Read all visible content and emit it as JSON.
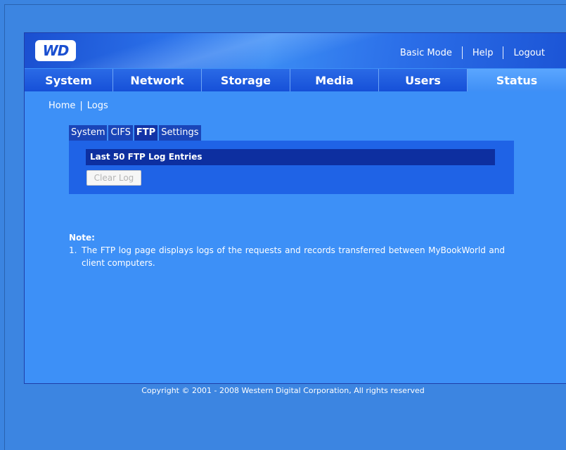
{
  "header": {
    "logo_text": "WD",
    "links": [
      "Basic Mode",
      "Help",
      "Logout"
    ]
  },
  "nav": {
    "items": [
      {
        "label": "System"
      },
      {
        "label": "Network"
      },
      {
        "label": "Storage"
      },
      {
        "label": "Media"
      },
      {
        "label": "Users"
      },
      {
        "label": "Status"
      }
    ],
    "active": "Status"
  },
  "breadcrumb": {
    "home": "Home",
    "separator": "|",
    "current": "Logs"
  },
  "subtabs": {
    "items": [
      {
        "label": "System"
      },
      {
        "label": "CIFS"
      },
      {
        "label": "FTP"
      },
      {
        "label": "Settings"
      }
    ],
    "active": "FTP"
  },
  "log_panel": {
    "title": "Last 50 FTP Log Entries",
    "clear_button": "Clear Log"
  },
  "note": {
    "title": "Note:",
    "items": [
      {
        "num": "1.",
        "text": "The FTP log page displays logs of the requests and records transferred between MyBookWorld and client computers."
      }
    ]
  },
  "footer": {
    "copyright": "Copyright © 2001 - 2008 Western Digital Corporation, All rights reserved"
  },
  "colors": {
    "background": "#3b84e0",
    "panel": "#3d90f7",
    "nav_bar": "#1a58e0",
    "nav_active": "#4f9cfb",
    "log_title_bar": "#0d2fa0"
  }
}
